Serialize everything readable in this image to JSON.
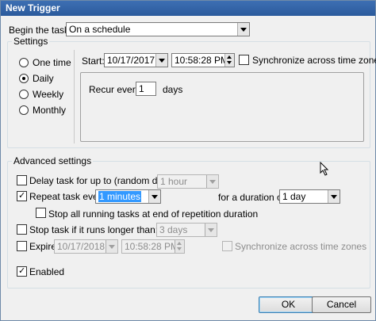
{
  "window": {
    "title": "New Trigger"
  },
  "begin": {
    "label": "Begin the task:",
    "value": "On a schedule"
  },
  "settings": {
    "group_title": "Settings",
    "radios": [
      {
        "label": "One time",
        "selected": false
      },
      {
        "label": "Daily",
        "selected": true
      },
      {
        "label": "Weekly",
        "selected": false
      },
      {
        "label": "Monthly",
        "selected": false
      }
    ],
    "start_label": "Start:",
    "start_date": "10/17/2017",
    "start_time": "10:58:28 PM",
    "sync_label": "Synchronize across time zones",
    "recur_label": "Recur every:",
    "recur_value": "1",
    "recur_unit": "days"
  },
  "advanced": {
    "group_title": "Advanced settings",
    "delay_label": "Delay task for up to (random delay):",
    "delay_value": "1 hour",
    "repeat_label": "Repeat task every:",
    "repeat_value": "1 minutes",
    "duration_label": "for a duration of:",
    "duration_value": "1 day",
    "stop_running_label": "Stop all running tasks at end of repetition duration",
    "stop_longer_label": "Stop task if it runs longer than:",
    "stop_longer_value": "3 days",
    "expire_label": "Expire:",
    "expire_date": "10/17/2018",
    "expire_time": "10:58:28 PM",
    "expire_sync_label": "Synchronize across time zones",
    "enabled_label": "Enabled"
  },
  "buttons": {
    "ok": "OK",
    "cancel": "Cancel"
  }
}
